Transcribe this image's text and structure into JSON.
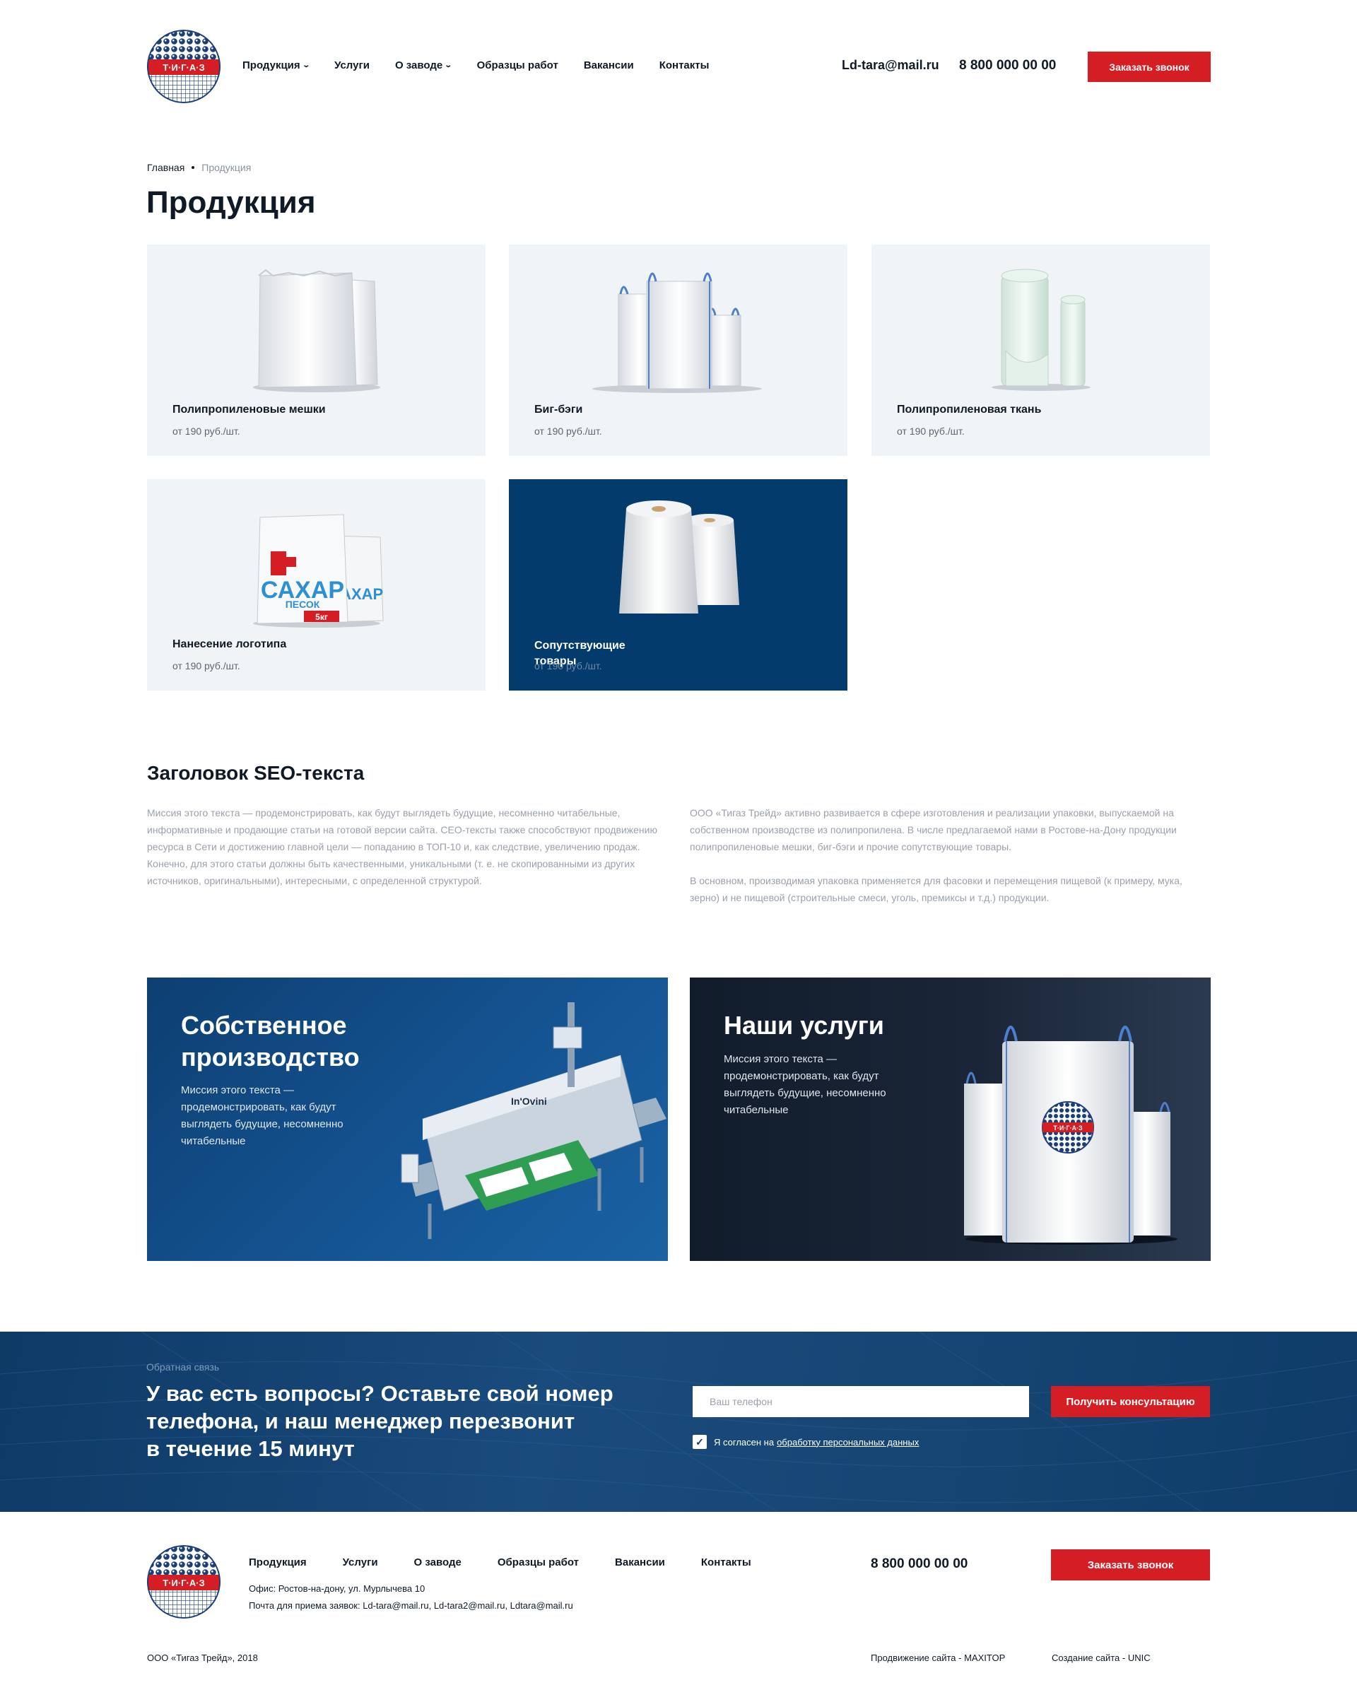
{
  "header": {
    "logo_text": "Т·И·Г·А·З",
    "nav": [
      {
        "label": "Продукция",
        "has_dropdown": true
      },
      {
        "label": "Услуги",
        "has_dropdown": false
      },
      {
        "label": "О заводе",
        "has_dropdown": true
      },
      {
        "label": "Образцы работ",
        "has_dropdown": false
      },
      {
        "label": "Вакансии",
        "has_dropdown": false
      },
      {
        "label": "Контакты",
        "has_dropdown": false
      }
    ],
    "email": "Ld-tara@mail.ru",
    "phone": "8 800 000 00 00",
    "call_button": "Заказать звонок"
  },
  "breadcrumb": {
    "home": "Главная",
    "current": "Продукция"
  },
  "page_title": "Продукция",
  "products": [
    {
      "name": "Полипропиленовые мешки",
      "price": "от 190 руб./шт.",
      "icon": "sacks-image"
    },
    {
      "name": "Биг-бэги",
      "price": "от 190 руб./шт.",
      "icon": "big-bags-image"
    },
    {
      "name": "Полипропиленовая ткань",
      "price": "от 190 руб./шт.",
      "icon": "fabric-rolls-image"
    },
    {
      "name": "Нанесение логотипа",
      "price": "от 190 руб./шт.",
      "icon": "printed-sacks-image",
      "print_text": "САХАР",
      "print_sub": "ПЕСОК",
      "print_weight": "5кг"
    },
    {
      "name": "Сопутствующие товары",
      "price": "от 190 руб./шт.",
      "icon": "yarn-bobbins-image"
    }
  ],
  "seo": {
    "title": "Заголовок SEO-текста",
    "left": "Миссия этого текста — продемонстрировать, как будут выглядеть будущие, несомненно читабельные, информативные и продающие статьи на готовой версии сайта. СЕО-тексты также способствуют продвижению ресурса в Сети и достижению главной цели — попаданию в ТОП-10 и, как следствие, увеличению продаж.\nКонечно, для этого статьи должны быть качественными, уникальными (т. е. не скопированными из других источников, оригинальными), интересными, с определенной структурой.",
    "right_1": "ООО «Тигаз Трейд» активно развивается в сфере изготовления и реализации упаковки, выпускаемой на собственном производстве из полипропилена. В числе предлагаемой нами в Ростове-на-Дону продукции полипропиленовые мешки, биг-бэги и прочие сопутствующие товары.",
    "right_2": "В основном, производимая упаковка применяется для фасовки и перемещения пищевой (к примеру, мука, зерно) и не пищевой (строительные смеси, уголь, премиксы и т.д.) продукции."
  },
  "banners": [
    {
      "title": "Собственное производство",
      "text": "Миссия этого текста — продемонстрировать, как будут выглядеть будущие, несомненно читабельные",
      "machine_label": "In'Ovini"
    },
    {
      "title": "Наши услуги",
      "text": "Миссия этого текста — продемонстрировать, как будут выглядеть будущие, несомненно читабельные"
    }
  ],
  "feedback": {
    "label": "Обратная связь",
    "title": "У вас есть вопросы? Оставьте свой номер\nтелефона, и наш менеджер перезвонит\nв течение 15 минут",
    "phone_placeholder": "Ваш телефон",
    "phone_value": "",
    "button": "Получить консультацию",
    "consent_text": "Я согласен на",
    "consent_link": "обработку персональных данных",
    "consent_checked": true
  },
  "footer": {
    "nav": [
      "Продукция",
      "Услуги",
      "О заводе",
      "Образцы работ",
      "Вакансии",
      "Контакты"
    ],
    "office": "Офис: Ростов-на-дону, ул. Мурлычева 10",
    "mail": "Почта для приема заявок: Ld-tara@mail.ru, Ld-tara2@mail.ru, Ldtara@mail.ru",
    "phone": "8 800 000 00 00",
    "call_button": "Заказать звонок",
    "copyright": "ООО «Тигаз Трейд», 2018",
    "promotion": "Продвижение сайта - MAXITOP",
    "creation": "Создание сайта - UNIC"
  },
  "colors": {
    "accent_red": "#d51d24",
    "navy": "#033c6c",
    "card_bg": "#f1f4f7",
    "text_dark": "#0f1a26"
  }
}
